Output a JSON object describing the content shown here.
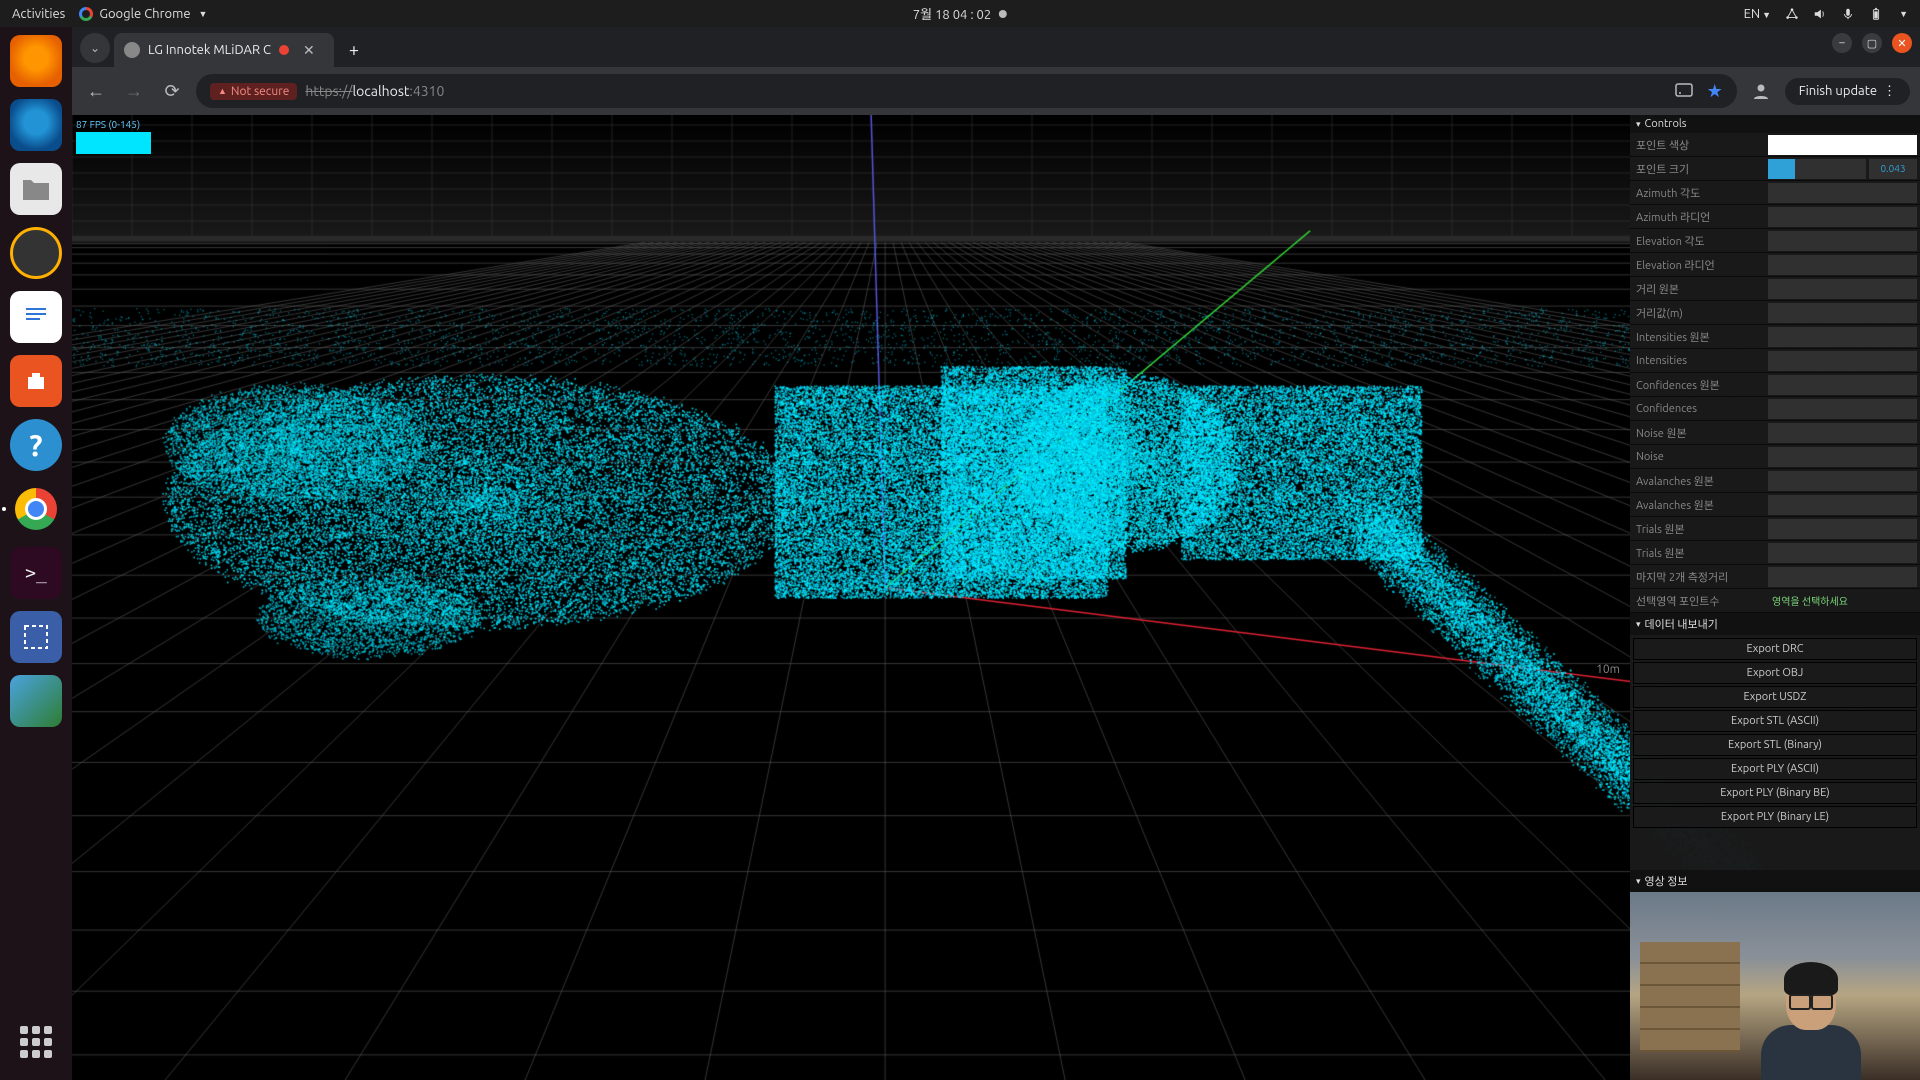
{
  "topbar": {
    "activities": "Activities",
    "app_name": "Google Chrome",
    "clock": "7월 18  04 : 02",
    "lang": "EN"
  },
  "dock": {
    "items": [
      "firefox",
      "thunderbird",
      "files",
      "rhythmbox",
      "libreoffice",
      "software",
      "help",
      "chrome",
      "terminal",
      "screenshot",
      "image-viewer"
    ]
  },
  "chrome": {
    "tab_title": "LG Innotek MLiDAR C",
    "not_secure": "Not secure",
    "url_scheme": "https://",
    "url_host": "localhost",
    "url_port": ":4310",
    "finish_update": "Finish update"
  },
  "fps": {
    "text": "87 FPS (0-145)"
  },
  "panel": {
    "controls_title": "Controls",
    "point_size_label": "포인트 크기",
    "point_size_value": "0.043",
    "rows": [
      "Azimuth 각도",
      "Azimuth 라디언",
      "Elevation 각도",
      "Elevation 라디언",
      "거리 원본",
      "거리값(m)",
      "Intensities 원본",
      "Intensities",
      "Confidences 원본",
      "Confidences",
      "Noise 원본",
      "Noise",
      "Avalanches 원본",
      "Avalanches 원본",
      "Trials 원본",
      "Trials 원본"
    ],
    "last_dist_label": "마지막 2개 측정거리",
    "sel_points_label": "선택영역 포인트수",
    "sel_points_msg": "영역을 선택하세요",
    "export_title": "데이터 내보내기",
    "export_buttons": [
      "Export DRC",
      "Export OBJ",
      "Export USDZ",
      "Export STL (ASCII)",
      "Export STL (Binary)",
      "Export PLY (ASCII)",
      "Export PLY (Binary BE)",
      "Export PLY (Binary LE)"
    ],
    "webcam_title": "영상 정보"
  }
}
